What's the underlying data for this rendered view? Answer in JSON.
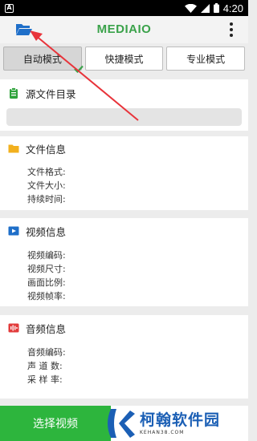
{
  "status_bar": {
    "left_icon": "A",
    "time": "4:20"
  },
  "app_bar": {
    "title": "MEDIAIO"
  },
  "tabs": [
    {
      "label": "自动模式"
    },
    {
      "label": "快捷模式"
    },
    {
      "label": "专业模式"
    }
  ],
  "source_dir": {
    "title": "源文件目录",
    "path_value": ""
  },
  "file_info": {
    "title": "文件信息",
    "rows": [
      "文件格式:",
      "文件大小:",
      "持续时间:"
    ]
  },
  "video_info": {
    "title": "视频信息",
    "rows": [
      "视频编码:",
      "视频尺寸:",
      "画面比例:",
      "视频帧率:"
    ]
  },
  "audio_info": {
    "title": "音频信息",
    "rows": [
      "音频编码:",
      "声 道 数:",
      "采 样 率:"
    ]
  },
  "bottom": {
    "select_video_label": "选择视频"
  },
  "watermark": {
    "name": "柯翰软件园",
    "domain": "KEHAN38.COM"
  },
  "colors": {
    "brand_green": "#3aa24a",
    "button_green": "#2db53d",
    "annotation_red": "#e8333a",
    "watermark_blue": "#1b5fb5"
  }
}
